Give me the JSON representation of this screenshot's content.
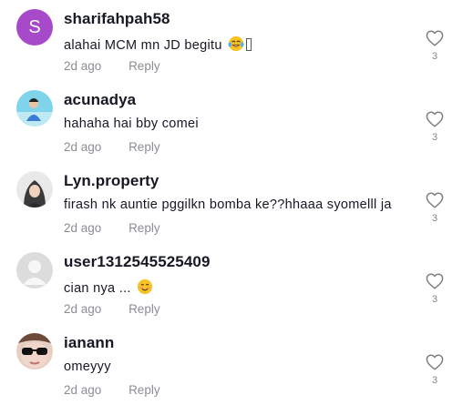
{
  "colors": {
    "text": "#161823",
    "muted": "#8a8b91",
    "avatar_purple": "#a64ac9"
  },
  "comments": [
    {
      "username": "sharifahpah58",
      "avatar_letter": "S",
      "text": "alahai MCM mn JD begitu",
      "emoji": "tears-of-joy",
      "time": "2d ago",
      "reply": "Reply",
      "likes": "3"
    },
    {
      "username": "acunadya",
      "text": "hahaha hai bby comei",
      "time": "2d ago",
      "reply": "Reply",
      "likes": "3"
    },
    {
      "username": "Lyn.property",
      "text": "firash nk auntie pggilkn bomba ke??hhaaa syomelll ja",
      "time": "2d ago",
      "reply": "Reply",
      "likes": "3"
    },
    {
      "username": "user1312545525409",
      "text": "cian nya ...",
      "emoji": "smiling-face",
      "time": "2d ago",
      "reply": "Reply",
      "likes": "3"
    },
    {
      "username": "ianann",
      "text": "omeyyy",
      "time": "2d ago",
      "reply": "Reply",
      "likes": "3"
    }
  ]
}
